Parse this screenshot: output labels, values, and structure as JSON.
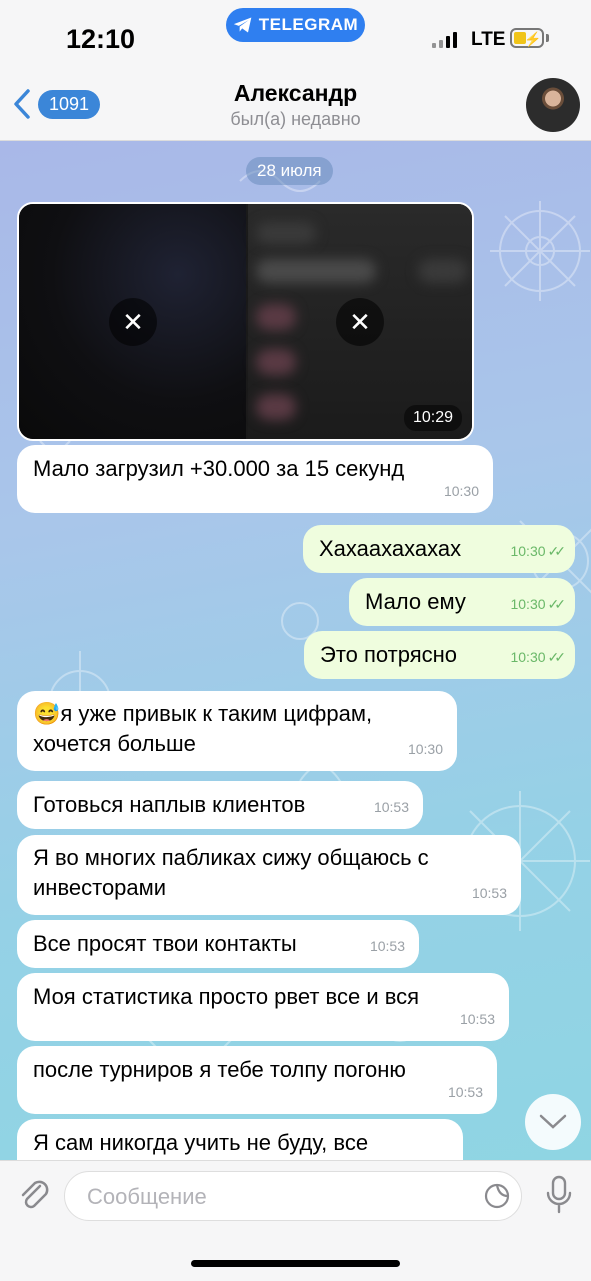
{
  "status": {
    "time": "12:10",
    "app_pill": "TELEGRAM",
    "network": "LTE"
  },
  "header": {
    "back_count": "1091",
    "title": "Александр",
    "subtitle": "был(а) недавно"
  },
  "chat": {
    "date": "28 июля",
    "media_time": "10:29",
    "messages": [
      {
        "dir": "in",
        "text": "Мало загрузил +30.000 за 15 секунд",
        "time": "10:30"
      },
      {
        "dir": "out",
        "text": "Хахаахахахах",
        "time": "10:30"
      },
      {
        "dir": "out",
        "text": "Мало ему",
        "time": "10:30"
      },
      {
        "dir": "out",
        "text": "Это потрясно",
        "time": "10:30"
      },
      {
        "dir": "in",
        "text": "😅я уже привык к таким цифрам, хочется больше",
        "time": "10:30"
      },
      {
        "dir": "in",
        "text": "Готовься наплыв клиентов",
        "time": "10:53"
      },
      {
        "dir": "in",
        "text": "Я во многих пабликах сижу общаюсь с инвесторами",
        "time": "10:53"
      },
      {
        "dir": "in",
        "text": "Все просят твои контакты",
        "time": "10:53"
      },
      {
        "dir": "in",
        "text": "Моя статистика просто рвет все и вся",
        "time": "10:53"
      },
      {
        "dir": "in",
        "text": "после турниров я тебе толпу погоню",
        "time": "10:53"
      },
      {
        "dir": "in",
        "text": "Я сам никогда учить не буду, все",
        "time": ""
      }
    ]
  },
  "input": {
    "placeholder": "Сообщение"
  },
  "icons": {
    "back": "chevron-left-icon",
    "attach": "paperclip-icon",
    "sticker": "sticker-icon",
    "mic": "microphone-icon",
    "scroll": "chevron-down-icon",
    "download": "close-icon"
  },
  "colors": {
    "accent": "#2f7ff0",
    "outgoing_bubble": "#effdde",
    "incoming_bubble": "#ffffff"
  }
}
